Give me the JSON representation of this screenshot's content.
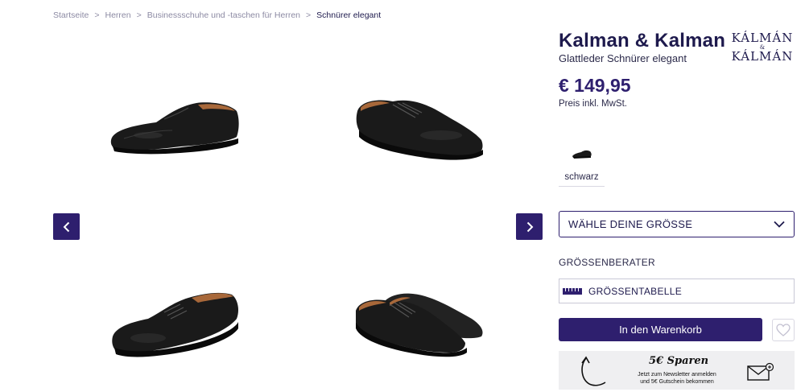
{
  "breadcrumb": {
    "items": [
      "Startseite",
      "Herren",
      "Businessschuhe und -taschen für Herren"
    ],
    "separator": ">",
    "current": "Schnürer elegant"
  },
  "gallery": {
    "prev_icon": "chevron-left-icon",
    "next_icon": "chevron-right-icon",
    "images": [
      "shoe-side-view",
      "shoe-three-quarter-view",
      "shoe-front-view",
      "shoe-pair-view"
    ]
  },
  "product": {
    "brand": "Kalman & Kalman",
    "name": "Glattleder Schnürer elegant",
    "price": "€ 149,95",
    "price_note": "Preis inkl. MwSt.",
    "logo_line1": "KÁLMÁN",
    "logo_amp": "&",
    "logo_line2": "KÁLMÁN"
  },
  "color": {
    "selected_label": "schwarz"
  },
  "size": {
    "select_label": "WÄHLE DEINE GRÖSSE",
    "advisor_label": "GRÖSSENBERATER",
    "table_label": "GRÖSSENTABELLE"
  },
  "actions": {
    "cart_label": "In den Warenkorb",
    "wishlist_icon": "heart-icon"
  },
  "newsletter": {
    "title": "5€ Sparen",
    "line1": "Jetzt zum Newsletter anmelden",
    "line2": "und 5€ Gutschein bekommen"
  },
  "colors": {
    "primary": "#2e1f6e",
    "text_dark": "#1e1a4d",
    "breadcrumb": "#8c8aa3"
  }
}
